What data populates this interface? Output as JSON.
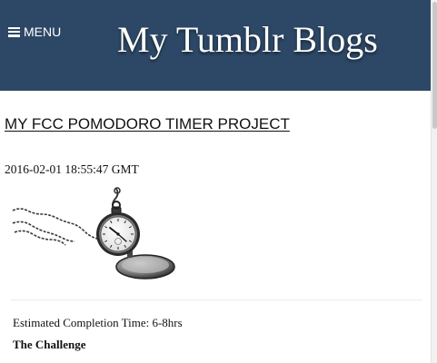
{
  "header": {
    "menu_label": "MENU",
    "site_title": "My Tumblr Blogs",
    "background_color": "#2d4866",
    "menu_icon": "hamburger-icon"
  },
  "post": {
    "title": "MY FCC POMODORO TIMER PROJECT",
    "date": "2016-02-01 18:55:47 GMT",
    "image_subject": "pocket-watch",
    "estimate": "Estimated Completion Time: 6-8hrs",
    "section_heading": "The Challenge"
  }
}
